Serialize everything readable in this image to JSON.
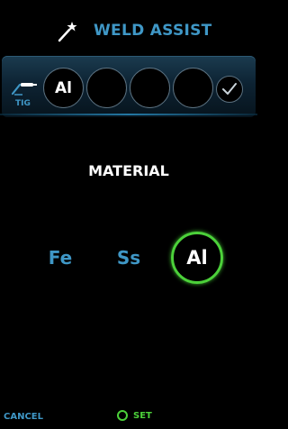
{
  "header": {
    "title": "WELD ASSIST",
    "icon": "magic-wand-icon"
  },
  "process_bar": {
    "process_icon": "tig-torch-icon",
    "process_label": "TIG",
    "slots": [
      "Al",
      "",
      "",
      ""
    ],
    "confirm_icon": "checkmark-icon"
  },
  "material": {
    "label": "MATERIAL",
    "options": [
      "Fe",
      "Ss",
      "Al"
    ],
    "selected": "Al"
  },
  "footer": {
    "cancel_label": "CANCEL",
    "set_label": "SET"
  },
  "colors": {
    "accent_blue": "#3f97c6",
    "select_green": "#4cd13a",
    "background": "#000000"
  }
}
